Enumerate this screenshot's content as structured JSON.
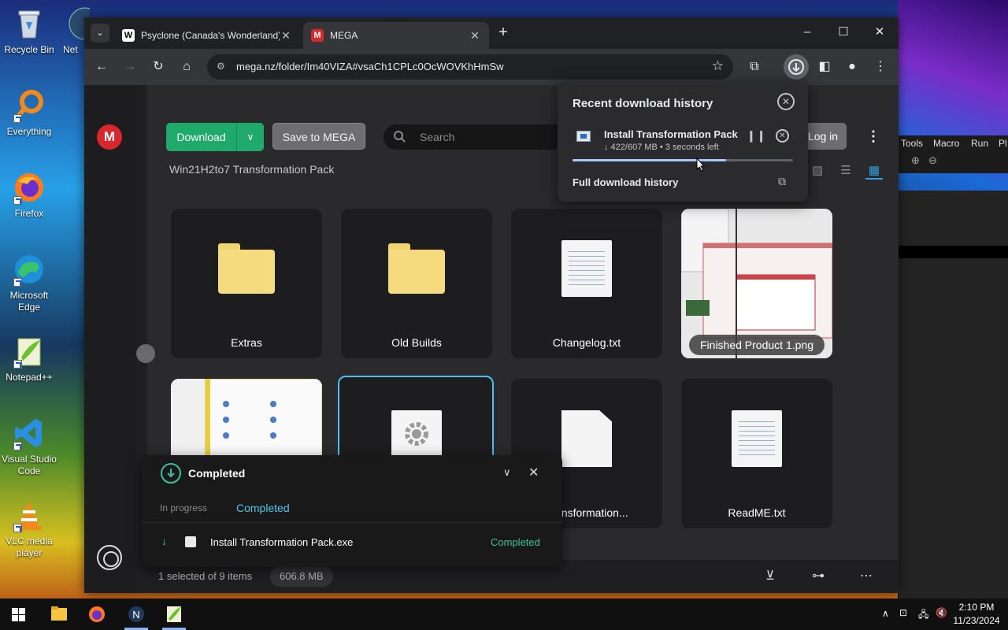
{
  "desktop": {
    "icons": [
      {
        "label": "Recycle Bin"
      },
      {
        "label": "Everything"
      },
      {
        "label": "Firefox"
      },
      {
        "label": "Microsoft Edge"
      },
      {
        "label": "Notepad++"
      },
      {
        "label": "Visual Studio Code"
      },
      {
        "label": "VLC media player"
      }
    ],
    "partial_icon_label": "Net"
  },
  "browser": {
    "tabs": [
      {
        "title": "Psyclone (Canada's Wonderland)",
        "favicon": "W",
        "active": false
      },
      {
        "title": "MEGA",
        "favicon": "M",
        "active": true
      }
    ],
    "url": "mega.nz/folder/Im40VIZA#vsaCh1CPLc0OcWOVKhHmSw"
  },
  "mega": {
    "download_label": "Download",
    "save_label": "Save to MEGA",
    "search_placeholder": "Search",
    "login_label": "Log in",
    "folder_title": "Win21H2to7 Transformation Pack",
    "items": [
      {
        "name": "Extras",
        "type": "folder"
      },
      {
        "name": "Old Builds",
        "type": "folder"
      },
      {
        "name": "Changelog.txt",
        "type": "text"
      },
      {
        "name": "Finished Product 1.png",
        "type": "image"
      },
      {
        "name": "",
        "type": "image"
      },
      {
        "name": "",
        "type": "exe",
        "selected": true
      },
      {
        "name": "Transformation...",
        "type": "file"
      },
      {
        "name": "ReadME.txt",
        "type": "text"
      }
    ],
    "status": {
      "selection": "1 selected of 9 items",
      "size": "606.8 MB"
    }
  },
  "transfer_panel": {
    "title": "Completed",
    "tab_in_progress": "In progress",
    "tab_completed": "Completed",
    "rows": [
      {
        "file": "Install Transformation Pack.exe",
        "status": "Completed"
      }
    ]
  },
  "download_bubble": {
    "title": "Recent download history",
    "file": "Install Transformation Pack.exe",
    "progress_text": "↓ 422/607 MB • 3 seconds left",
    "progress_fraction": 0.695,
    "full_history_label": "Full download history"
  },
  "background_app": {
    "menu": [
      "Tools",
      "Macro",
      "Run",
      "Pl"
    ]
  },
  "taskbar": {
    "time": "2:10 PM",
    "date": "11/23/2024"
  },
  "colors": {
    "mega_red": "#d9272e",
    "mega_green": "#1fa96a",
    "accent_blue": "#4cc0f0",
    "completed_green": "#3cc19a"
  }
}
